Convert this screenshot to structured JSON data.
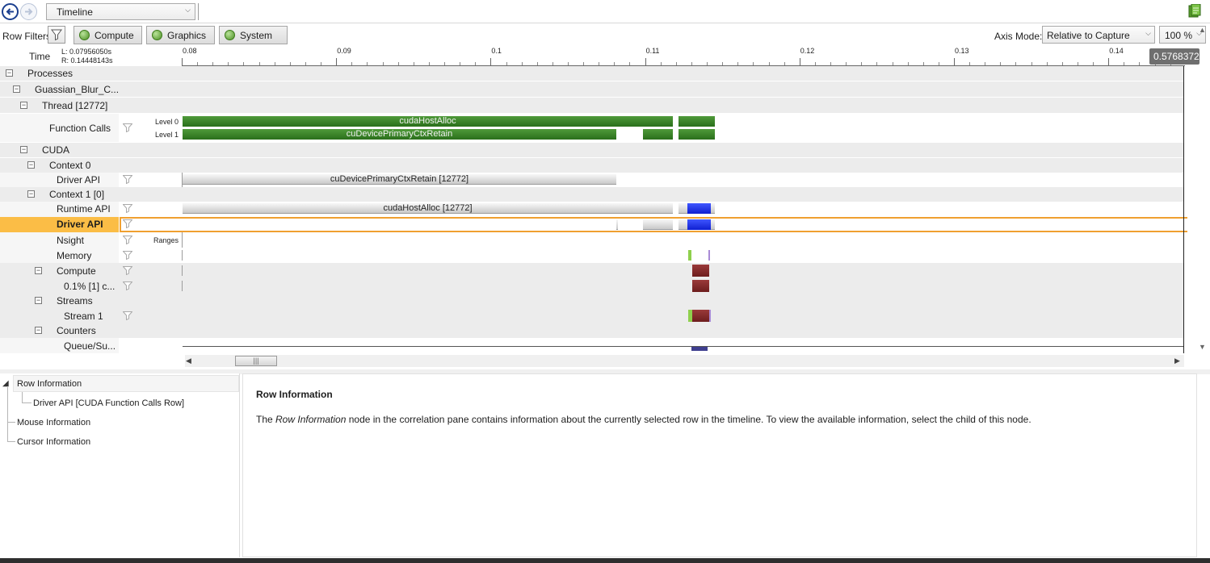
{
  "toolbar": {
    "view_selector": "Timeline",
    "back_icon": "back-arrow-icon",
    "forward_icon": "forward-arrow-icon"
  },
  "filters": {
    "label": "Row Filters",
    "buttons": [
      "Compute",
      "Graphics",
      "System"
    ],
    "axis_mode_label": "Axis Mode:",
    "axis_mode_value": "Relative to Capture",
    "zoom_value": "100 %"
  },
  "ruler": {
    "label": "Time",
    "left": "L: 0.07956050s",
    "right": "R: 0.14448143s",
    "ticks": [
      "0.08",
      "0.09",
      "0.1",
      "0.11",
      "0.12",
      "0.13",
      "0.14"
    ],
    "cursor_readout": "0.5768372"
  },
  "rows": {
    "processes": "Processes",
    "process": "Guassian_Blur_C...",
    "thread": "Thread [12772]",
    "function_calls": "Function Calls",
    "level0": "Level 0",
    "level1": "Level 1",
    "fc_bar1": "cudaHostAlloc",
    "fc_bar2": "cuDevicePrimaryCtxRetain",
    "cuda": "CUDA",
    "context0": "Context 0",
    "driver_api": "Driver API",
    "ctx0_bar": "cuDevicePrimaryCtxRetain [12772]",
    "context1": "Context 1 [0]",
    "runtime_api": "Runtime API",
    "runtime_bar": "cudaHostAlloc [12772]",
    "driver_api_selected": "Driver API",
    "nsight": "Nsight",
    "ranges": "Ranges",
    "memory": "Memory",
    "compute": "Compute",
    "compute_child": "0.1% [1] c...",
    "streams": "Streams",
    "stream1": "Stream 1",
    "counters": "Counters",
    "queue": "Queue/Su..."
  },
  "bottom": {
    "tree": {
      "row_info": "Row Information",
      "driver_api_item": "Driver API [CUDA Function Calls Row]",
      "mouse_info": "Mouse Information",
      "cursor_info": "Cursor Information"
    },
    "info_title": "Row Information",
    "info_text_pre": "The ",
    "info_text_em": "Row Information",
    "info_text_post": " node in the correlation pane contains information about the currently selected row in the timeline. To view the available information, select the child of this node."
  },
  "colors": {
    "green_bar": "#2a6f1b",
    "blue_bar": "#0f1fd0",
    "red_bar": "#6d1d1d",
    "selection": "#fbbd46"
  }
}
